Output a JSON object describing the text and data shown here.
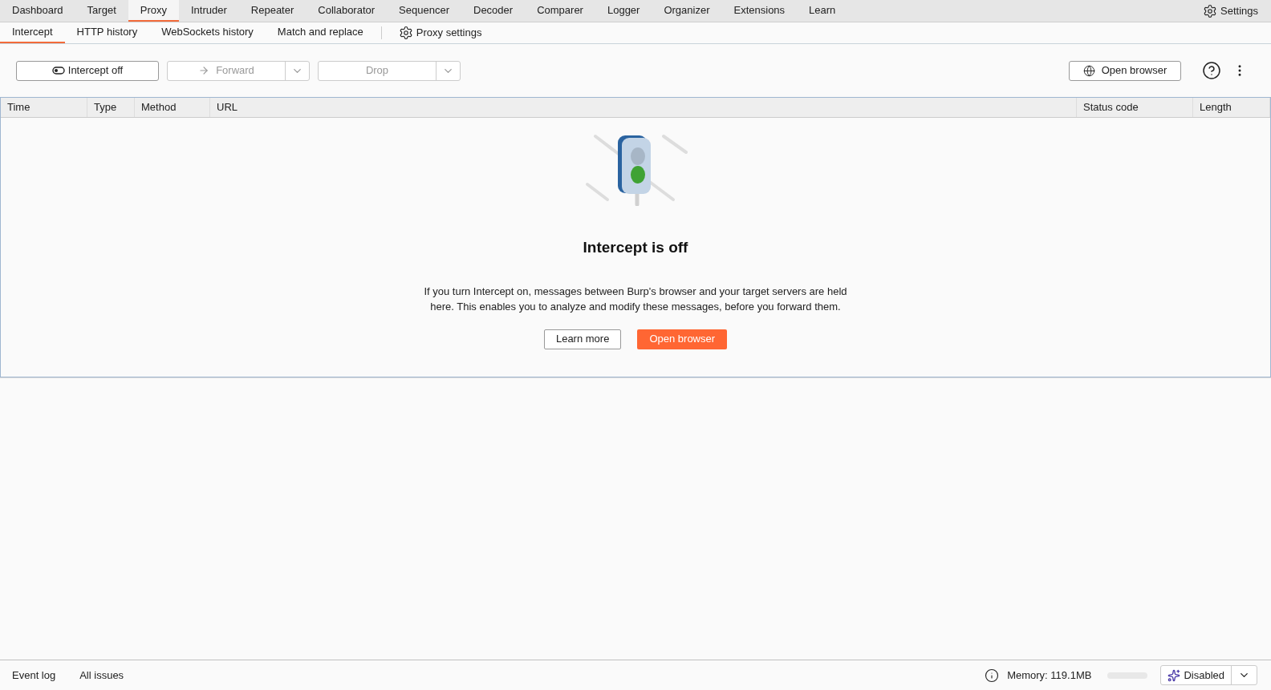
{
  "main_tabs": [
    {
      "label": "Dashboard",
      "selected": false
    },
    {
      "label": "Target",
      "selected": false
    },
    {
      "label": "Proxy",
      "selected": true
    },
    {
      "label": "Intruder",
      "selected": false
    },
    {
      "label": "Repeater",
      "selected": false
    },
    {
      "label": "Collaborator",
      "selected": false
    },
    {
      "label": "Sequencer",
      "selected": false
    },
    {
      "label": "Decoder",
      "selected": false
    },
    {
      "label": "Comparer",
      "selected": false
    },
    {
      "label": "Logger",
      "selected": false
    },
    {
      "label": "Organizer",
      "selected": false
    },
    {
      "label": "Extensions",
      "selected": false
    },
    {
      "label": "Learn",
      "selected": false
    }
  ],
  "settings_button": "Settings",
  "sub_tabs": [
    {
      "label": "Intercept",
      "selected": true
    },
    {
      "label": "HTTP history",
      "selected": false
    },
    {
      "label": "WebSockets history",
      "selected": false
    },
    {
      "label": "Match and replace",
      "selected": false
    }
  ],
  "proxy_settings": "Proxy settings",
  "toolbar": {
    "intercept": {
      "label": "Intercept off",
      "on": false
    },
    "forward": {
      "label": "Forward",
      "disabled": true
    },
    "drop": {
      "label": "Drop",
      "disabled": true
    },
    "open_browser": "Open browser"
  },
  "table": {
    "columns": [
      "Time",
      "Type",
      "Method",
      "URL",
      "Status code",
      "Length"
    ]
  },
  "empty_state": {
    "title": "Intercept is off",
    "message": "If you turn Intercept on, messages between Burp's browser and your target servers are held here. This enables you to analyze and modify these messages, before you forward them.",
    "learn_more": "Learn more",
    "open_browser": "Open browser"
  },
  "status_bar": {
    "left": [
      "Event log",
      "All issues"
    ],
    "memory": "Memory: 119.1MB",
    "ai": "Disabled"
  }
}
